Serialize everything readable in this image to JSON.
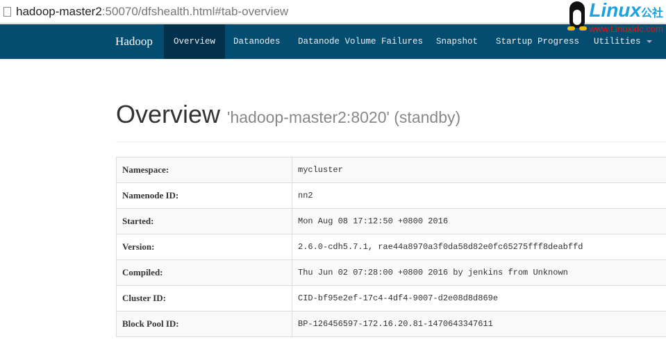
{
  "browser": {
    "url_host": "hadoop-master2",
    "url_rest": ":50070/dfshealth.html#tab-overview"
  },
  "watermark": {
    "text": "Linux",
    "suffix": "公社",
    "site": "www.Linuxidc.com"
  },
  "nav": {
    "brand": "Hadoop",
    "items": [
      {
        "label": "Overview"
      },
      {
        "label": "Datanodes"
      },
      {
        "label": "Datanode Volume Failures"
      },
      {
        "label": "Snapshot"
      },
      {
        "label": "Startup Progress"
      },
      {
        "label": "Utilities"
      }
    ]
  },
  "page": {
    "title": "Overview",
    "subtitle": "'hadoop-master2:8020' (standby)"
  },
  "rows": [
    {
      "k": "Namespace:",
      "v": "mycluster"
    },
    {
      "k": "Namenode ID:",
      "v": "nn2"
    },
    {
      "k": "Started:",
      "v": "Mon Aug 08 17:12:50 +0800 2016"
    },
    {
      "k": "Version:",
      "v": "2.6.0-cdh5.7.1, rae44a8970a3f0da58d82e0fc65275fff8deabffd"
    },
    {
      "k": "Compiled:",
      "v": "Thu Jun 02 07:28:00 +0800 2016 by jenkins from Unknown"
    },
    {
      "k": "Cluster ID:",
      "v": "CID-bf95e2ef-17c4-4df4-9007-d2e08d8d869e"
    },
    {
      "k": "Block Pool ID:",
      "v": "BP-126456597-172.16.20.81-1470643347611"
    }
  ]
}
